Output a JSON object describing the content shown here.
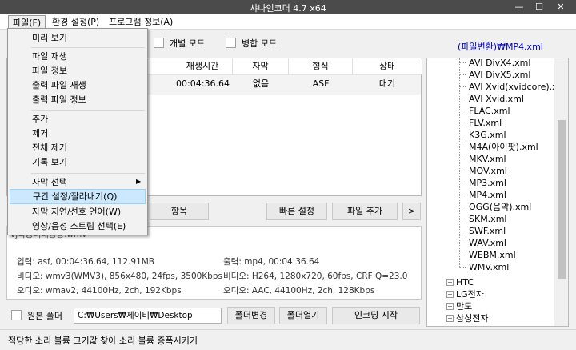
{
  "window": {
    "title": "샤나인코더 4.7 x64",
    "minimize": "—",
    "maximize": "☐",
    "close": "✕"
  },
  "menubar": [
    {
      "label": "파일(F)"
    },
    {
      "label": "환경 설정(P)"
    },
    {
      "label": "프로그램 정보(A)"
    }
  ],
  "toolbar": {
    "individual_mode": "개별 모드",
    "merge_mode": "병합 모드",
    "preset_link": "(파일변환)₩MP4.xml"
  },
  "table": {
    "headers": [
      "재생시간",
      "자막",
      "형식",
      "상태"
    ],
    "row": [
      "00:04:36.64",
      "없음",
      "ASF",
      "대기"
    ]
  },
  "buttons": {
    "items": "항목",
    "quick_settings": "빠른 설정",
    "add_file": "파일 추가",
    "more": ">"
  },
  "info": {
    "filename": "vj특공대대공항.wmv",
    "input": "입력: asf, 00:04:36.64, 112.91MB",
    "input_video": "비디오: wmv3(WMV3), 856x480, 24fps, 3500Kbps",
    "input_audio": "오디오: wmav2, 44100Hz, 2ch, 192Kbps",
    "output": "출력: mp4, 00:04:36.64",
    "output_video": "비디오: H264, 1280x720, 60fps, CRF Q=23.0",
    "output_audio": "오디오: AAC, 44100Hz, 2ch, 128Kbps"
  },
  "bottom": {
    "original_folder": "원본 폴더",
    "path": "C:₩Users₩제이비₩Desktop",
    "change_folder": "폴더변경",
    "open_folder": "폴더열기",
    "start_encoding": "인코딩 시작"
  },
  "tree": {
    "files": [
      "AVI DivX4.xml",
      "AVI DivX5.xml",
      "AVI Xvid(xvidcore).xml",
      "AVI Xvid.xml",
      "FLAC.xml",
      "FLV.xml",
      "K3G.xml",
      "M4A(아이팟).xml",
      "MKV.xml",
      "MOV.xml",
      "MP3.xml",
      "MP4.xml",
      "OGG(음악).xml",
      "SKM.xml",
      "SWF.xml",
      "WAV.xml",
      "WEBM.xml",
      "WMV.xml"
    ],
    "folders": [
      "HTC",
      "LG전자",
      "만도",
      "삼성전자"
    ]
  },
  "status": "적당한 소리 볼륨 크기값 찾아 소리 볼륨 증폭시키기",
  "file_menu": {
    "items": [
      "미리 보기",
      "파일 재생",
      "파일 정보",
      "출력 파일 재생",
      "출력 파일 정보",
      "추가",
      "제거",
      "전체 제거",
      "기록 보기",
      "자막 선택",
      "구간 설정/잘라내기(Q)",
      "자막 지연/선호 언어(W)",
      "영상/음성 스트림 선택(E)"
    ],
    "submenu_arrow": "▶"
  },
  "colors": {
    "titlebar": "#4b4b4b",
    "link": "#0000cc",
    "highlight": "#cce8ff"
  }
}
